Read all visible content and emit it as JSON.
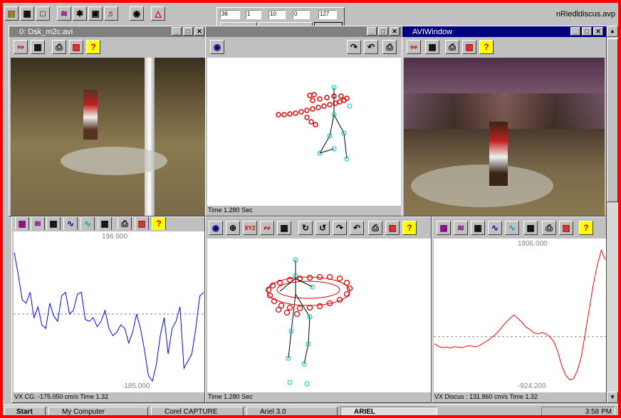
{
  "app": {
    "file_title": "nRiedldiscus.avp",
    "accent": "#ff0000",
    "titlebar_active": "#000080",
    "titlebar_inactive": "#808080"
  },
  "main_toolbar": {
    "icons": [
      "open-folder-icon",
      "save-icon",
      "new-file-icon",
      "graph-icon",
      "run-figure-icon",
      "camera-capture-icon",
      "runner-icon",
      "snapshot-icon",
      "warning-icon"
    ]
  },
  "frame_control": {
    "fields": [
      "36",
      "1",
      "10",
      "0",
      "127"
    ],
    "buttons": [
      "step-back",
      "play",
      "step-forward",
      "stop-yellow",
      "stop-red",
      "reset"
    ]
  },
  "windows": {
    "video_left": {
      "title": "0: Dsk_m2c.avi"
    },
    "center_top": {
      "status": "Time 1.280 Sec"
    },
    "avi_right": {
      "title": "AVIWindow"
    },
    "graph_left": {
      "ymax_label": "196.900",
      "ymin_label": "-185.000",
      "status": "VX CG: -175.050 cm/s Time 1.32"
    },
    "center_bottom": {
      "status": "Time 1.280 Sec"
    },
    "graph_right": {
      "ymax_label": "1806.000",
      "ymin_label": "-924.200",
      "status": "VX Discus   : 131.860 cm/s Time 1.32"
    }
  },
  "taskbar": {
    "start": "Start",
    "items": [
      "My Computer",
      "Corel CAPTURE",
      "Ariel 3.0",
      "ARIEL"
    ],
    "clock": "3:58 PM"
  },
  "chart_data": [
    {
      "type": "line",
      "title": "",
      "ylim": [
        -185.0,
        196.9
      ],
      "series": [
        {
          "values": [
            170,
            110,
            40,
            30,
            60,
            -10,
            20,
            -30,
            -40,
            30,
            -5,
            -20,
            50,
            60,
            0,
            10,
            55,
            60,
            -15,
            -20,
            -10,
            -35,
            -20,
            10,
            -40,
            -60,
            -50,
            -30,
            -40,
            -80,
            -50,
            0,
            -40,
            -100,
            -170,
            -185,
            -140,
            -60,
            -10,
            -110,
            -40,
            -20,
            20,
            -150,
            -130,
            -110,
            -40,
            50,
            60
          ]
        }
      ],
      "color": "#0000ff"
    },
    {
      "type": "line",
      "title": "",
      "ylim": [
        -924.2,
        1806.0
      ],
      "series": [
        {
          "values": [
            -150,
            -200,
            -230,
            -220,
            -240,
            -210,
            -220,
            -230,
            -200,
            -190,
            -210,
            -200,
            -150,
            -100,
            -50,
            20,
            100,
            200,
            300,
            380,
            450,
            380,
            300,
            200,
            150,
            80,
            60,
            80,
            60,
            0,
            -100,
            -300,
            -600,
            -800,
            -900,
            -880,
            -700,
            -400,
            100,
            600,
            1100,
            1500,
            1800,
            1600
          ]
        }
      ],
      "color": "#ff0000"
    }
  ]
}
